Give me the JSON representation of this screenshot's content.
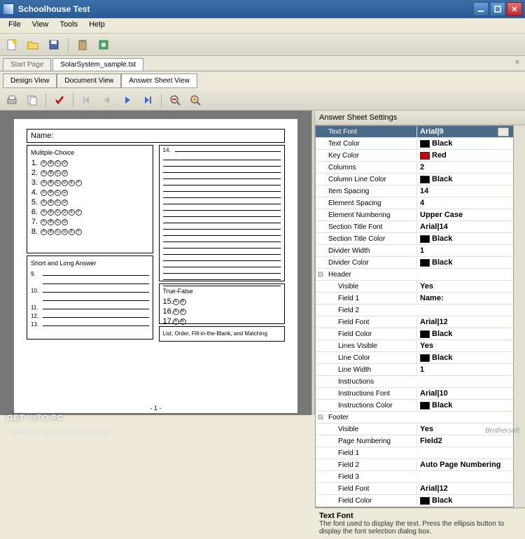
{
  "window": {
    "title": "Schoolhouse Test"
  },
  "menu": [
    "File",
    "View",
    "Tools",
    "Help"
  ],
  "tabs": {
    "start": "Start Page",
    "file": "SolarSystem_sample.tst"
  },
  "views": [
    "Design View",
    "Document View",
    "Answer Sheet View"
  ],
  "settings_title": "Answer Sheet Settings",
  "props": [
    {
      "k": "Text Font",
      "v": "Arial|9",
      "sel": true,
      "ell": true
    },
    {
      "k": "Text Color",
      "v": "Black",
      "sw": "#000000"
    },
    {
      "k": "Key Color",
      "v": "Red",
      "sw": "#cc0000"
    },
    {
      "k": "Columns",
      "v": "2"
    },
    {
      "k": "Column Line Color",
      "v": "Black",
      "sw": "#000000"
    },
    {
      "k": "Item Spacing",
      "v": "14"
    },
    {
      "k": "Element Spacing",
      "v": "4"
    },
    {
      "k": "Element Numbering",
      "v": "Upper Case"
    },
    {
      "k": "Section Title Font",
      "v": "Arial|14"
    },
    {
      "k": "Section Title Color",
      "v": "Black",
      "sw": "#000000"
    },
    {
      "k": "Divider Width",
      "v": "1"
    },
    {
      "k": "Divider Color",
      "v": "Black",
      "sw": "#000000"
    },
    {
      "k": "Header",
      "exp": true
    },
    {
      "k": "Visible",
      "v": "Yes",
      "ind": true
    },
    {
      "k": "Field 1",
      "v": "Name:",
      "ind": true
    },
    {
      "k": "Field 2",
      "v": "",
      "ind": true
    },
    {
      "k": "Field Font",
      "v": "Arial|12",
      "ind": true
    },
    {
      "k": "Field Color",
      "v": "Black",
      "sw": "#000000",
      "ind": true
    },
    {
      "k": "Lines  Visible",
      "v": "Yes",
      "ind": true
    },
    {
      "k": "Line Color",
      "v": "Black",
      "sw": "#000000",
      "ind": true
    },
    {
      "k": "Line Width",
      "v": "1",
      "ind": true
    },
    {
      "k": "Instructions",
      "v": "",
      "ind": true
    },
    {
      "k": "Instructions Font",
      "v": "Arial|10",
      "ind": true
    },
    {
      "k": "Instructions Color",
      "v": "Black",
      "sw": "#000000",
      "ind": true
    },
    {
      "k": "Footer",
      "exp": true
    },
    {
      "k": "Visible",
      "v": "Yes",
      "ind": true
    },
    {
      "k": "Page Numbering",
      "v": "Field2",
      "ind": true
    },
    {
      "k": "Field 1",
      "v": "",
      "ind": true
    },
    {
      "k": "Field 2",
      "v": "Auto Page Numbering",
      "ind": true
    },
    {
      "k": "Field 3",
      "v": "",
      "ind": true
    },
    {
      "k": "Field Font",
      "v": "Arial|12",
      "ind": true
    },
    {
      "k": "Field Color",
      "v": "Black",
      "sw": "#000000",
      "ind": true
    }
  ],
  "desc": {
    "title": "Text Font",
    "text": "The font used to display the text. Press the ellipsis button to display the font selection dialog box."
  },
  "page": {
    "name_label": "Name:",
    "mc_title": "Mulitple-Choice",
    "sl_title": "Short and Long Answer",
    "tf_title": "True-False",
    "list_title": "List, Order, Fill-in-the-Blank, and Matching",
    "pagenum": "- 1 -"
  },
  "watermark": {
    "t1": "GET ",
    "t2": "INTO",
    "t3": " PC",
    "sub": "Download Free Your Desired App"
  },
  "brand": "Brothersoft"
}
